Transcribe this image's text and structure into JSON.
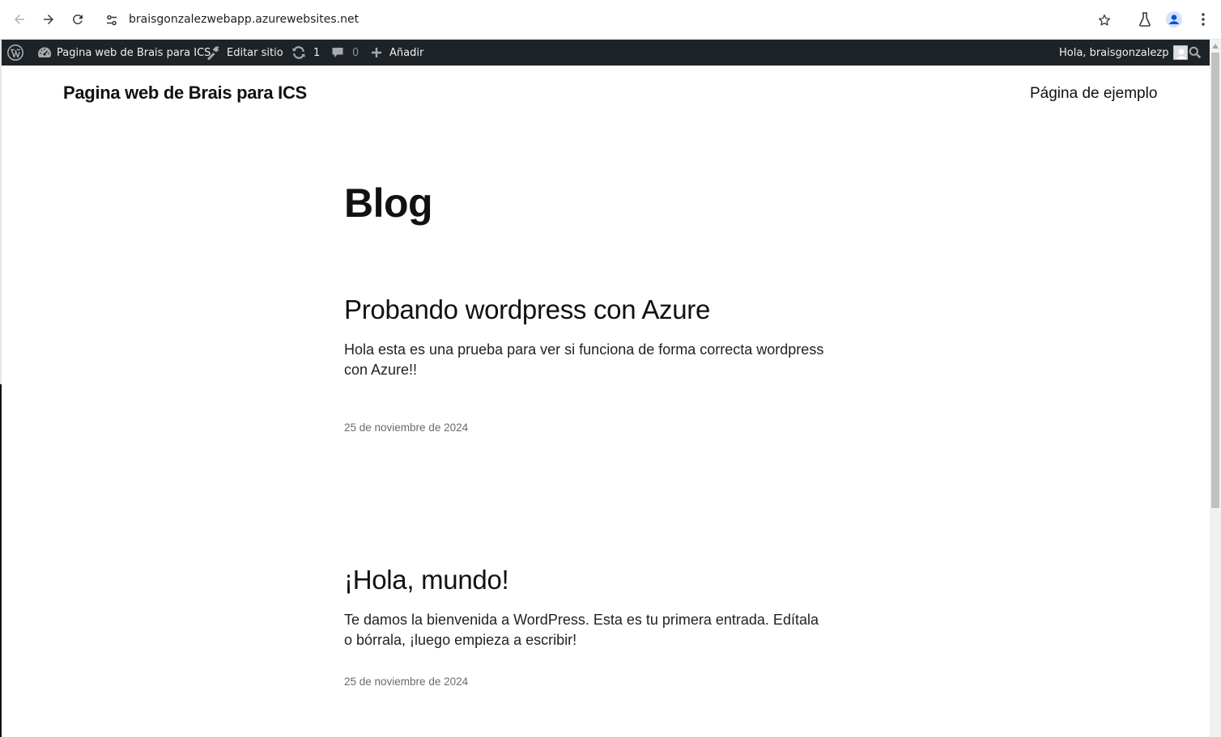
{
  "browser": {
    "url": "braisgonzalezwebapp.azurewebsites.net",
    "icons": {
      "back": "arrow-left-icon",
      "forward": "arrow-right-icon",
      "reload": "reload-icon",
      "site_info": "tune-icon",
      "bookmark": "star-icon",
      "labs": "flask-icon",
      "profile": "profile-icon",
      "menu": "kebab-menu-icon"
    }
  },
  "admin_bar": {
    "site_name": "Pagina web de Brais para ICS",
    "edit_site": "Editar sitio",
    "updates_count": "1",
    "comments_count": "0",
    "add_new": "Añadir",
    "greeting": "Hola, braisgonzalezp",
    "colors": {
      "background": "#1d2327",
      "text": "#f0f0f1",
      "muted": "#8c8f94"
    }
  },
  "site": {
    "title": "Pagina web de Brais para ICS",
    "nav": [
      {
        "label": "Página de ejemplo"
      }
    ]
  },
  "main": {
    "heading": "Blog",
    "posts": [
      {
        "title": "Probando wordpress con Azure",
        "excerpt": "Hola esta es una prueba para ver si funciona de forma correcta wordpress con Azure!!",
        "date": "25 de noviembre de 2024"
      },
      {
        "title": "¡Hola, mundo!",
        "excerpt": "Te damos la bienvenida a WordPress. Esta es tu primera entrada. Edítala o bórrala, ¡luego empieza a escribir!",
        "date": "25 de noviembre de 2024"
      }
    ]
  }
}
